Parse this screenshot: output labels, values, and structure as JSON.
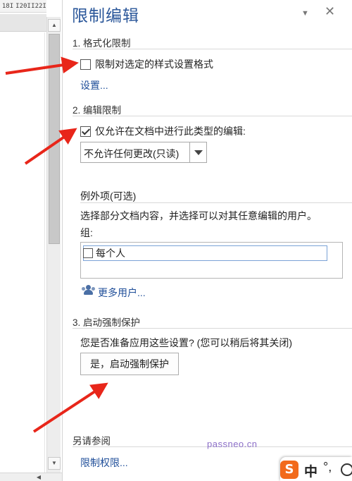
{
  "ruler": {
    "marks": [
      "18I",
      "I20I",
      "I22I"
    ]
  },
  "pane": {
    "title": "限制编辑",
    "menu_glyph": "▼",
    "close_glyph": "✕"
  },
  "section1": {
    "heading": "1. 格式化限制",
    "checkbox_label": "限制对选定的样式设置格式",
    "checkbox_checked": false,
    "settings_link": "设置..."
  },
  "section2": {
    "heading": "2. 编辑限制",
    "checkbox_label": "仅允许在文档中进行此类型的编辑:",
    "checkbox_checked": true,
    "edit_type_value": "不允许任何更改(只读)",
    "exceptions_heading": "例外项(可选)",
    "exceptions_desc": "选择部分文档内容，并选择可以对其任意编辑的用户。",
    "groups_label": "组:",
    "groups": [
      {
        "label": "每个人",
        "checked": false
      }
    ],
    "more_users_link": "更多用户..."
  },
  "section3": {
    "heading": "3. 启动强制保护",
    "question": "您是否准备应用这些设置? (您可以稍后将其关闭)",
    "start_button": "是，启动强制保护"
  },
  "see_also": {
    "heading": "另请参阅",
    "link": "限制权限..."
  },
  "watermark": "passneo.cn",
  "ime": {
    "logo": "S",
    "mode": "中",
    "punct": "°,",
    "emoji_icon": "smiley-icon"
  },
  "colors": {
    "title_blue": "#2b579a",
    "link_blue": "#1f4e99",
    "arrow_red": "#e8261a"
  }
}
